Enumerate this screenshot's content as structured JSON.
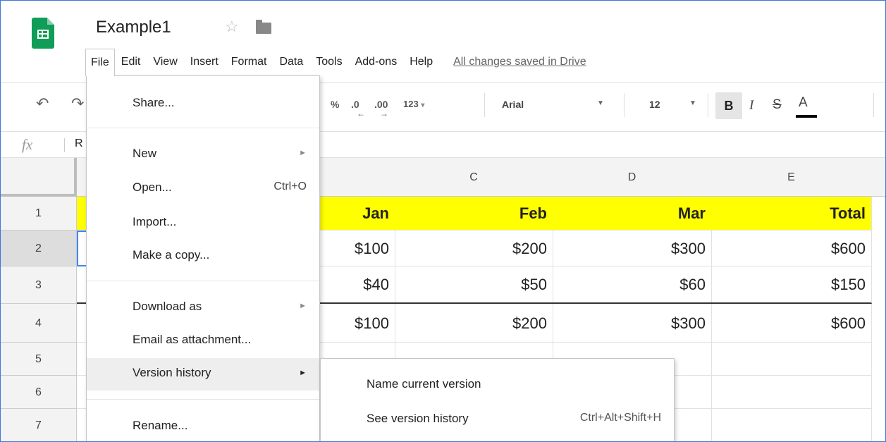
{
  "app": {
    "doc_title": "Example1",
    "star_icon": "star-outline-icon",
    "folder_icon": "folder-icon",
    "saved_status": "All changes saved in Drive"
  },
  "menubar": [
    "File",
    "Edit",
    "View",
    "Insert",
    "Format",
    "Data",
    "Tools",
    "Add-ons",
    "Help"
  ],
  "toolbar": {
    "percent": "%",
    "decrease_decimals": ".0",
    "increase_decimals": ".00",
    "number_formats": "123",
    "font": "Arial",
    "font_size": "12",
    "bold": "B",
    "italic": "I",
    "strikethrough": "S",
    "text_color": "A"
  },
  "formula_bar": {
    "fx_label": "fx",
    "content": "R"
  },
  "grid": {
    "columns": [
      "C",
      "D",
      "E"
    ],
    "row_numbers": [
      "1",
      "2",
      "3",
      "4",
      "5",
      "6",
      "7"
    ],
    "rows": [
      [
        "Jan",
        "Feb",
        "Mar",
        "Total"
      ],
      [
        "$100",
        "$200",
        "$300",
        "$600"
      ],
      [
        "$40",
        "$50",
        "$60",
        "$150"
      ],
      [
        "$100",
        "$200",
        "$300",
        "$600"
      ]
    ]
  },
  "file_menu": {
    "items": [
      {
        "label": "Share...",
        "shortcut": "",
        "submenu": false
      },
      {
        "label": "New",
        "shortcut": "",
        "submenu": true
      },
      {
        "label": "Open...",
        "shortcut": "Ctrl+O",
        "submenu": false
      },
      {
        "label": "Import...",
        "shortcut": "",
        "submenu": false
      },
      {
        "label": "Make a copy...",
        "shortcut": "",
        "submenu": false
      },
      {
        "label": "Download as",
        "shortcut": "",
        "submenu": true
      },
      {
        "label": "Email as attachment...",
        "shortcut": "",
        "submenu": false
      },
      {
        "label": "Version history",
        "shortcut": "",
        "submenu": true
      },
      {
        "label": "Rename...",
        "shortcut": "",
        "submenu": false
      }
    ]
  },
  "version_submenu": {
    "items": [
      {
        "label": "Name current version",
        "shortcut": ""
      },
      {
        "label": "See version history",
        "shortcut": "Ctrl+Alt+Shift+H"
      }
    ]
  },
  "colors": {
    "header_yellow": "#ffff00",
    "sheets_green": "#0f9d58",
    "selection_blue": "#4285f4"
  }
}
